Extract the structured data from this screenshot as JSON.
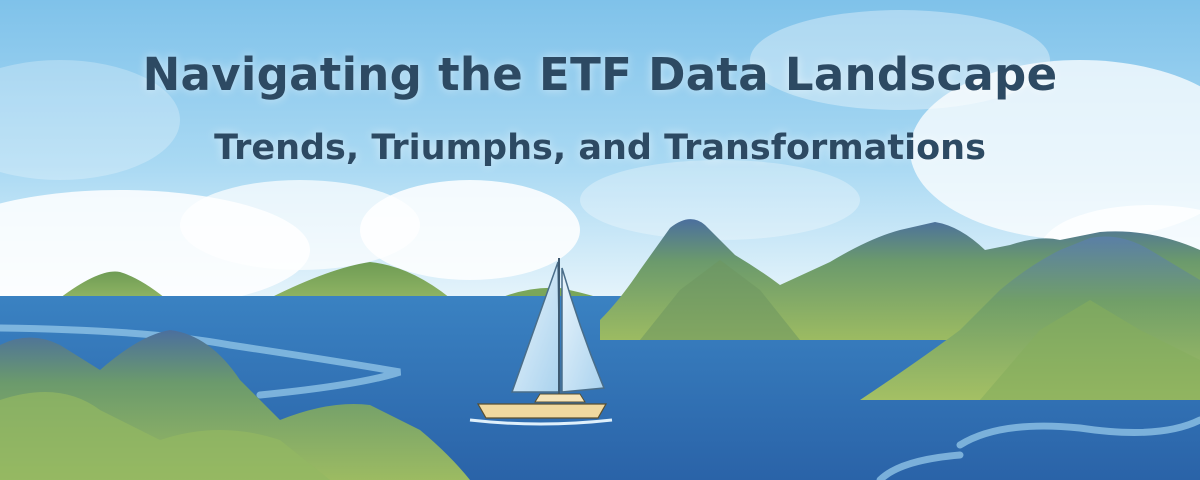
{
  "banner": {
    "title": "Navigating the ETF Data Landscape",
    "subtitle": "Trends, Triumphs, and Transformations"
  },
  "illustration": {
    "scene": "watercolor seascape with green mountains and a sailing catamaran",
    "colors": {
      "sky": "#8ecbec",
      "sea": "#2f72b8",
      "mountain_green": "#7ea55a",
      "mountain_blue": "#456c9c",
      "title_text": "#2d4a63",
      "boat_hull": "#f0d9a0",
      "sail": "#cfe6f5"
    }
  }
}
